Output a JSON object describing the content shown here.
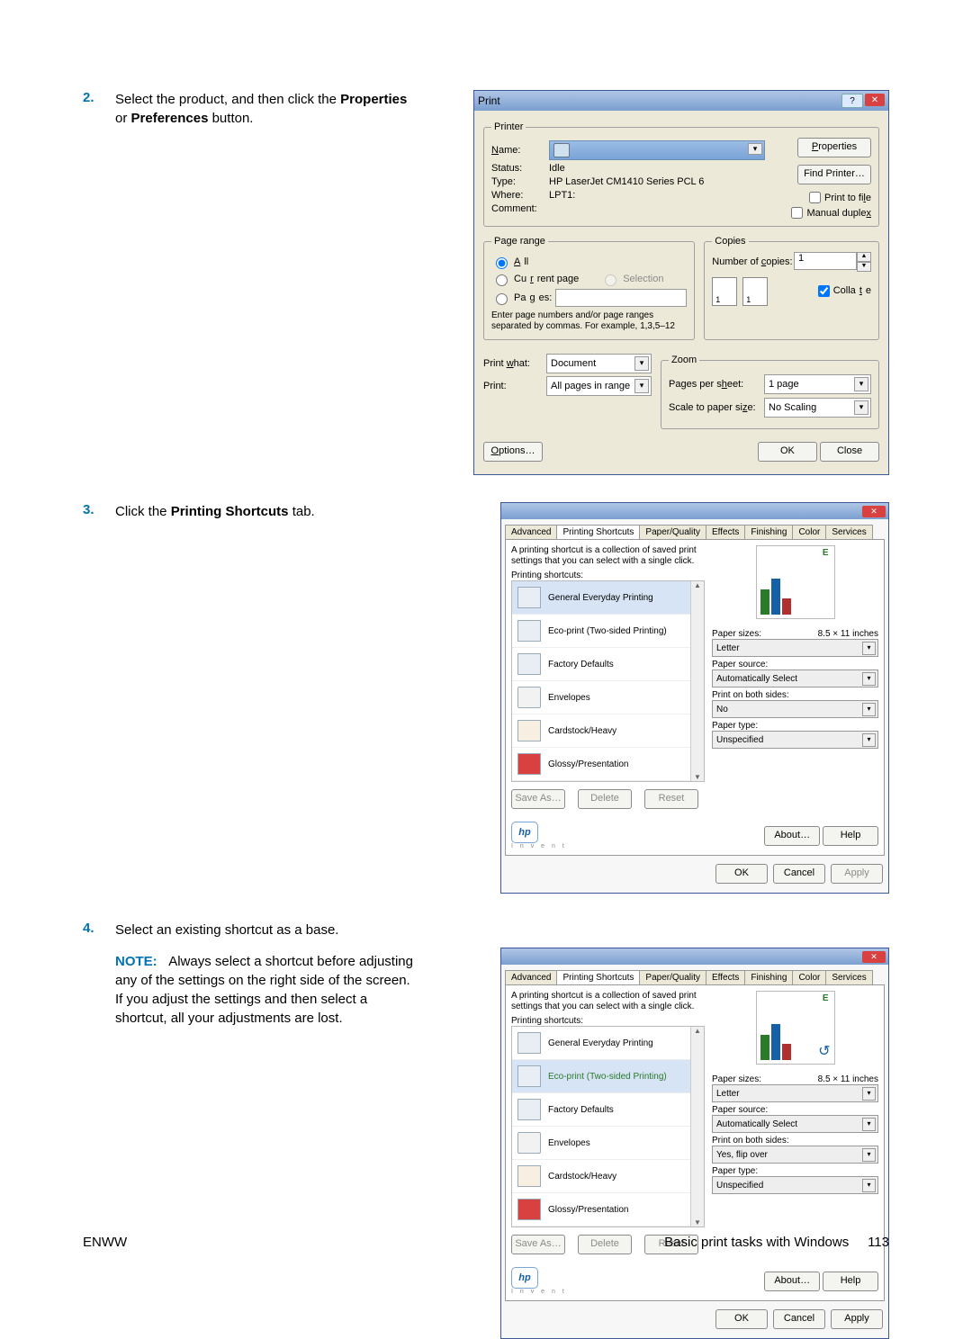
{
  "steps": {
    "s2": {
      "num": "2.",
      "text_a": "Select the product, and then click the ",
      "text_b": " or ",
      "bold1": "Properties",
      "bold2": "Preferences",
      "text_c": " button."
    },
    "s3": {
      "num": "3.",
      "text_a": "Click the ",
      "bold1": "Printing Shortcuts",
      "text_b": " tab."
    },
    "s4": {
      "num": "4.",
      "text": "Select an existing shortcut as a base.",
      "note_label": "NOTE:",
      "note_text": "Always select a shortcut before adjusting any of the settings on the right side of the screen. If you adjust the settings and then select a shortcut, all your adjustments are lost."
    }
  },
  "print_dialog": {
    "title": "Print",
    "printer_legend": "Printer",
    "name_label": "Name:",
    "status_label": "Status:",
    "status_val": "Idle",
    "type_label": "Type:",
    "type_val": "HP LaserJet CM1410 Series PCL 6",
    "where_label": "Where:",
    "where_val": "LPT1:",
    "comment_label": "Comment:",
    "btn_properties": "Properties",
    "btn_find": "Find Printer…",
    "chk_printfile": "Print to file",
    "chk_manual": "Manual duplex",
    "range_legend": "Page range",
    "range_all": "All",
    "range_current": "Current page",
    "range_selection": "Selection",
    "range_pages": "Pages:",
    "range_hint": "Enter page numbers and/or page ranges separated by commas. For example, 1,3,5–12",
    "copies_legend": "Copies",
    "copies_label": "Number of copies:",
    "copies_val": "1",
    "collate": "Collate",
    "printwhat_label": "Print what:",
    "printwhat_val": "Document",
    "print_label": "Print:",
    "print_val": "All pages in range",
    "zoom_legend": "Zoom",
    "pps_label": "Pages per sheet:",
    "pps_val": "1 page",
    "scale_label": "Scale to paper size:",
    "scale_val": "No Scaling",
    "btn_options": "Options…",
    "btn_ok": "OK",
    "btn_close": "Close",
    "name_underline": "N",
    "all_underline": "A",
    "cp_underline": "r",
    "copies_underline": "c",
    "collate_underline": "t",
    "duplex_underline": "x",
    "printwhat_underline": "w",
    "options_underline": "O"
  },
  "props1": {
    "tabs": {
      "advanced": "Advanced",
      "shortcuts": "Printing Shortcuts",
      "pq": "Paper/Quality",
      "effects": "Effects",
      "finishing": "Finishing",
      "color": "Color",
      "services": "Services"
    },
    "desc": "A printing shortcut is a collection of saved print settings that you can select with a single click.",
    "list_label": "Printing shortcuts:",
    "items": {
      "general": "General Everyday Printing",
      "eco": "Eco-print (Two-sided Printing)",
      "factory": "Factory Defaults",
      "envelopes": "Envelopes",
      "cardstock": "Cardstock/Heavy",
      "glossy": "Glossy/Presentation"
    },
    "actions": {
      "save": "Save As…",
      "delete": "Delete",
      "reset": "Reset"
    },
    "paper_sizes": "Paper sizes:",
    "paper_sizes_dim": "8.5 × 11 inches",
    "paper_sizes_val": "Letter",
    "paper_source": "Paper source:",
    "paper_source_val": "Automatically Select",
    "both_sides": "Print on both sides:",
    "both_sides_val": "No",
    "paper_type": "Paper type:",
    "paper_type_val": "Unspecified",
    "btn_about": "About…",
    "btn_help": "Help",
    "btn_ok": "OK",
    "btn_cancel": "Cancel",
    "btn_apply": "Apply",
    "preview_letter": "E"
  },
  "props2": {
    "both_sides_val": "Yes, flip over"
  },
  "footer": {
    "left": "ENWW",
    "right_text": "Basic print tasks with Windows",
    "page": "113"
  }
}
